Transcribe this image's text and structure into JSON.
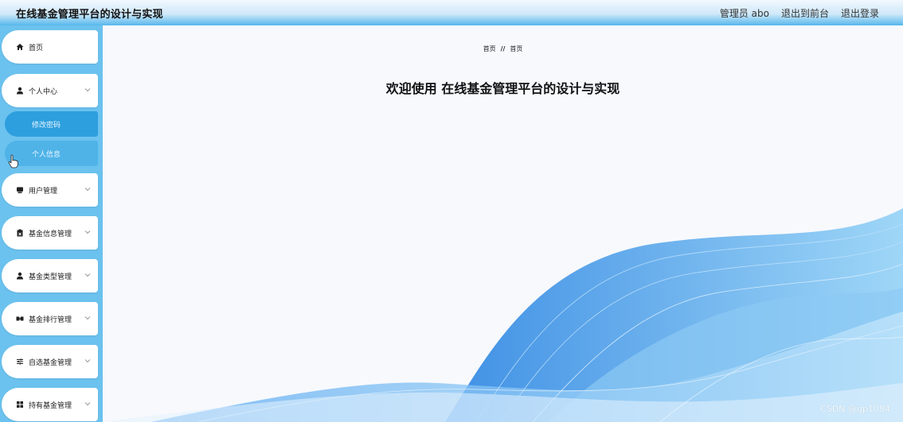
{
  "header": {
    "title": "在线基金管理平台的设计与实现",
    "user_label": "管理员 abo",
    "front_label": "退出到前台",
    "logout_label": "退出登录"
  },
  "sidebar": {
    "home": {
      "label": "首页",
      "icon": "home-icon"
    },
    "personal": {
      "label": "个人中心",
      "icon": "user-icon"
    },
    "sub_items": [
      {
        "label": "修改密码",
        "active": true
      },
      {
        "label": "个人信息",
        "active": false
      }
    ],
    "menus": [
      {
        "label": "用户管理",
        "icon": "user-manage-icon"
      },
      {
        "label": "基金信息管理",
        "icon": "clipboard-icon"
      },
      {
        "label": "基金类型管理",
        "icon": "user-icon"
      },
      {
        "label": "基金排行管理",
        "icon": "ranking-icon"
      },
      {
        "label": "自选基金管理",
        "icon": "sliders-icon"
      },
      {
        "label": "持有基金管理",
        "icon": "grid-icon"
      }
    ]
  },
  "main": {
    "breadcrumb": {
      "first": "首页",
      "separator": "//",
      "second": "首页"
    },
    "welcome": "欢迎使用 在线基金管理平台的设计与实现"
  },
  "watermark": "CSDN @gp1084",
  "colors": {
    "accent": "#2d9fde",
    "sidebar_bg": "#6bc2ee",
    "wave": "#3a93e8"
  }
}
